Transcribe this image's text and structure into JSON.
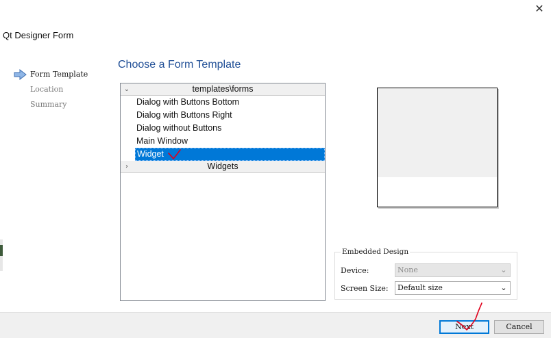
{
  "window": {
    "title": "Qt Designer Form",
    "close_glyph": "✕"
  },
  "wizard": {
    "steps": [
      {
        "label": "Form Template",
        "active": true
      },
      {
        "label": "Location",
        "active": false
      },
      {
        "label": "Summary",
        "active": false
      }
    ],
    "current_step_icon": "arrow-right-icon"
  },
  "page": {
    "heading": "Choose a Form Template"
  },
  "templates": {
    "groups": [
      {
        "label": "templates\\forms",
        "expanded": true,
        "items": [
          "Dialog with Buttons Bottom",
          "Dialog with Buttons Right",
          "Dialog without Buttons",
          "Main Window",
          "Widget"
        ],
        "selected": "Widget"
      },
      {
        "label": "Widgets",
        "expanded": false
      }
    ]
  },
  "embedded_design": {
    "legend": "Embedded Design",
    "device": {
      "label": "Device:",
      "value": "None",
      "enabled": false
    },
    "screen_size": {
      "label": "Screen Size:",
      "value": "Default size",
      "enabled": true
    }
  },
  "buttons": {
    "next": "Next",
    "cancel": "Cancel"
  },
  "colors": {
    "accent": "#0078d7",
    "heading": "#1f4e96",
    "annotation": "#e0001b"
  }
}
